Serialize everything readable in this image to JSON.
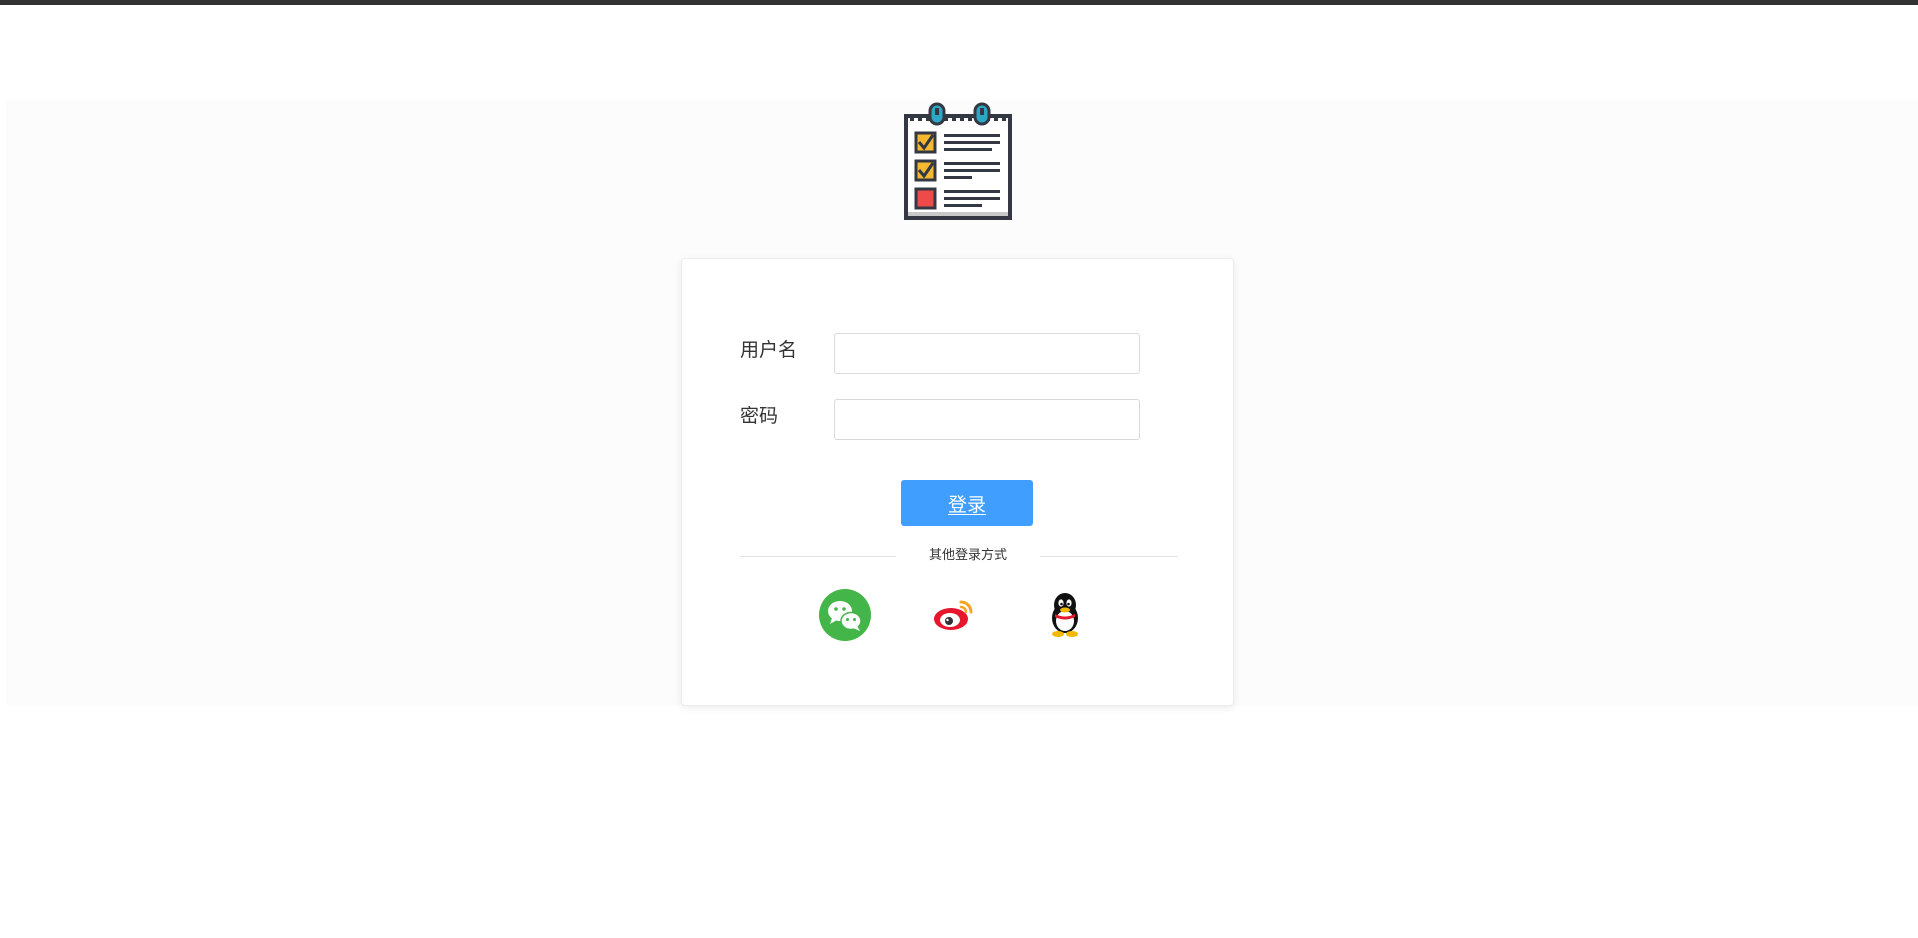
{
  "login_form": {
    "username_label": "用户名",
    "username_value": "",
    "password_label": "密码",
    "password_value": "",
    "submit_label": "登录"
  },
  "other_login": {
    "label": "其他登录方式",
    "providers": [
      {
        "name": "wechat",
        "icon": "wechat-icon",
        "color": "#44b549"
      },
      {
        "name": "weibo",
        "icon": "weibo-icon",
        "color": "#e6162d"
      },
      {
        "name": "qq",
        "icon": "qq-icon",
        "color": "#000000"
      }
    ]
  },
  "colors": {
    "primary": "#409eff",
    "top_bar": "#333333",
    "page_band": "#fcfcfc"
  }
}
